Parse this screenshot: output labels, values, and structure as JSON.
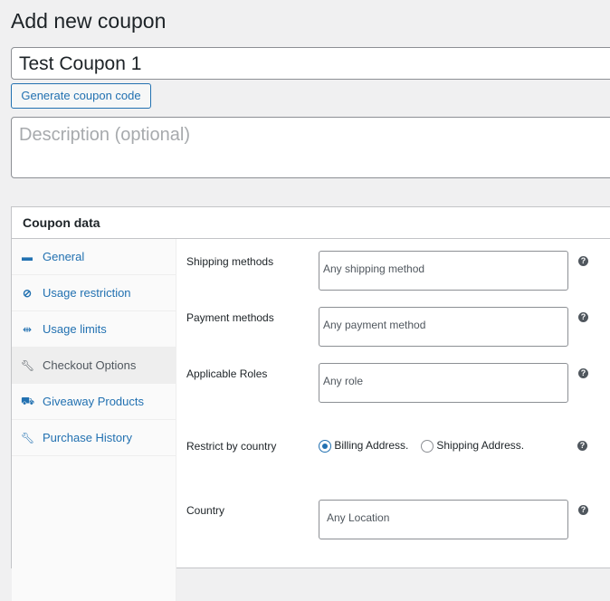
{
  "page_title": "Add new coupon",
  "coupon_title": "Test Coupon 1",
  "generate_label": "Generate coupon code",
  "description_placeholder": "Description (optional)",
  "panel_title": "Coupon data",
  "tabs": [
    {
      "label": "General",
      "icon": "ticket-icon"
    },
    {
      "label": "Usage restriction",
      "icon": "block-icon"
    },
    {
      "label": "Usage limits",
      "icon": "limits-icon"
    },
    {
      "label": "Checkout Options",
      "icon": "wrench-icon",
      "active": true
    },
    {
      "label": "Giveaway Products",
      "icon": "cart-icon"
    },
    {
      "label": "Purchase History",
      "icon": "wrench-icon"
    }
  ],
  "fields": {
    "shipping": {
      "label": "Shipping methods",
      "placeholder": "Any shipping method"
    },
    "payment": {
      "label": "Payment methods",
      "placeholder": "Any payment method"
    },
    "roles": {
      "label": "Applicable Roles",
      "placeholder": "Any role"
    },
    "restrict": {
      "label": "Restrict by country",
      "options": [
        "Billing Address.",
        "Shipping Address."
      ],
      "selected": "Billing Address."
    },
    "country": {
      "label": "Country",
      "placeholder": "Any Location"
    }
  },
  "help_glyph": "?",
  "accent": "#2271b1"
}
